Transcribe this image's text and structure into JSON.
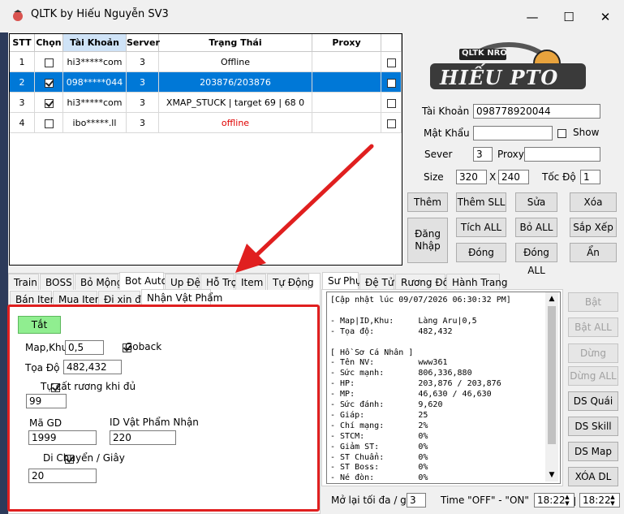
{
  "window": {
    "title": "QLTK by Hiếu Nguyễn SV3",
    "minimize": "—",
    "maximize": "☐",
    "close": "✕"
  },
  "grid": {
    "headers": [
      "STT",
      "Chọn",
      "Tài Khoản",
      "Server",
      "Trạng Thái",
      "Proxy"
    ],
    "rows": [
      {
        "stt": "1",
        "chon": false,
        "account": "hi3*****com",
        "server": "3",
        "status": "Offline",
        "status_color": "#000000",
        "proxy": "",
        "selected": false
      },
      {
        "stt": "2",
        "chon": true,
        "account": "098*****044",
        "server": "3",
        "status": "203876/203876",
        "status_color": "#ffffff",
        "proxy": "",
        "selected": true
      },
      {
        "stt": "3",
        "chon": true,
        "account": "hi3*****com",
        "server": "3",
        "status": "XMAP_STUCK | target 69 | 68 0",
        "status_color": "#000000",
        "proxy": "",
        "selected": false
      },
      {
        "stt": "4",
        "chon": false,
        "account": "ibo*****.ll",
        "server": "3",
        "status": "offline",
        "status_color": "#e00000",
        "proxy": "",
        "selected": false
      }
    ]
  },
  "logo": {
    "badge": "QLTK NRO",
    "text": "HIẾU PTO"
  },
  "account_form": {
    "tai_khoan_label": "Tài Khoản",
    "tai_khoan_value": "098778920044",
    "mat_khau_label": "Mật Khẩu",
    "mat_khau_value": "",
    "show_label": "Show",
    "sever_label": "Sever",
    "sever_value": "3",
    "proxy_label": "Proxy",
    "proxy_value": "",
    "size_label": "Size",
    "size_w": "320",
    "size_x": "X",
    "size_h": "240",
    "toc_do_label": "Tốc Độ",
    "toc_do_value": "1"
  },
  "actions": {
    "them": "Thêm",
    "them_sll": "Thêm SLL",
    "sua": "Sửa",
    "xoa": "Xóa",
    "dang_nhap": "Đăng Nhập",
    "tich_all": "Tích ALL",
    "bo_all": "Bỏ  ALL",
    "sap_xep": "Sắp Xếp",
    "dong": "Đóng",
    "dong_all": "Đóng ALL",
    "an": "Ẩn"
  },
  "main_tabs": [
    "Train",
    "BOSS",
    "Bỏ Mộng",
    "Bot Auto",
    "Up Đệ",
    "Hỗ Trợ",
    "Item",
    "Tự Động"
  ],
  "sub_tabs": [
    "Bán Item",
    "Mua Item",
    "Đi xin đồ",
    "Nhận Vật Phẩm"
  ],
  "bot_panel": {
    "toggle": "Tắt",
    "map_khu_label": "Map,Khu",
    "map_khu_value": "0,5",
    "goback_label": "Goback",
    "toa_do_label": "Tọa Độ",
    "toa_do_value": "482,432",
    "tu_cat_label": "Tự cất rương khi đủ",
    "tu_cat_value": "99",
    "ma_gd_label": "Mã GD",
    "ma_gd_value": "1999",
    "id_vp_label": "ID Vật Phẩm Nhận",
    "id_vp_value": "220",
    "di_chuyen_label": "Di Chuyển / Giây",
    "di_chuyen_value": "20"
  },
  "right_tabs": [
    "Sư Phụ",
    "Đệ Tử",
    "Rương Đồ",
    "Hành Trang"
  ],
  "log_lines": [
    "[Cập nhật lúc 09/07/2026 06:30:32 PM]",
    "",
    "- Map|ID,Khu:     Làng Aru|0,5",
    "- Tọa độ:         482,432",
    "",
    "[ Hồ Sơ Cá Nhân ]",
    "- Tên NV:         www361",
    "- Sức mạnh:       806,336,880",
    "- HP:             203,876 / 203,876",
    "- MP:             46,630 / 46,630",
    "- Sức đánh:       9,620",
    "- Giáp:           25",
    "- Chí mạng:       2%",
    "- STCM:           0%",
    "- Giảm ST:        0%",
    "- ST Chuẩn:       0%",
    "- ST Boss:        0%",
    "- Né đòn:         0%"
  ],
  "side_buttons": {
    "bat": "Bật",
    "bat_all": "Bật ALL",
    "dung": "Dừng",
    "dung_all": "Dừng ALL",
    "ds_quai": "DS Quái",
    "ds_skill": "DS Skill",
    "ds_map": "DS Map",
    "xoa_dl": "XÓA DL"
  },
  "footer": {
    "mo_lai_label": "Mở lại tối đa / giờ",
    "mo_lai_value": "3",
    "time_label": "Time \"OFF\" - \"ON\"",
    "time1": "18:22",
    "time2": "18:22"
  },
  "colors": {
    "selection": "#0078d7",
    "toggle_green": "#90ee90",
    "annotation_red": "#e01f1f"
  }
}
